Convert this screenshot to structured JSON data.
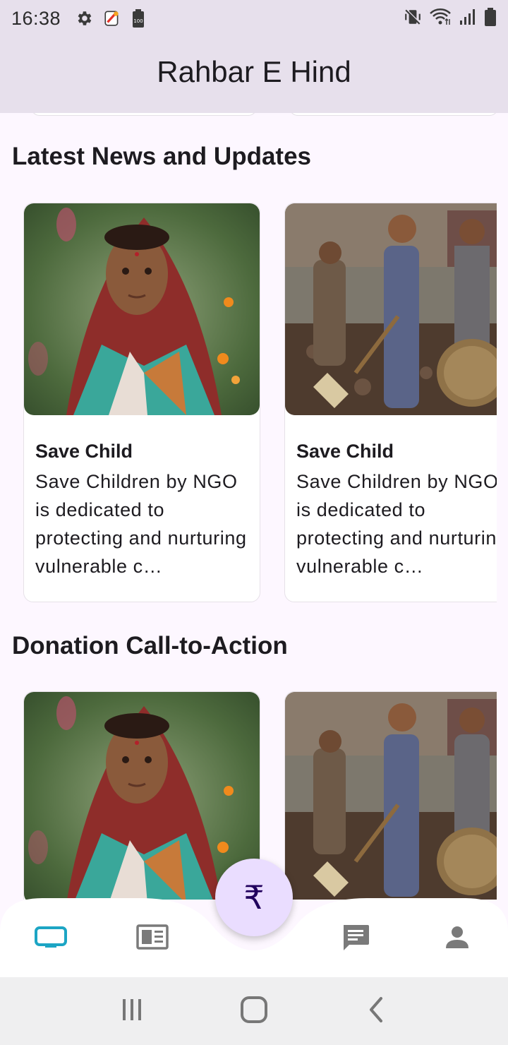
{
  "status_bar": {
    "time": "16:38",
    "left_icons": [
      "settings-icon",
      "app-notification-icon",
      "battery-saver-icon"
    ],
    "right_icons": [
      "vibrate-mute-icon",
      "wifi-icon",
      "signal-icon",
      "battery-icon"
    ],
    "battery_small_label": "100"
  },
  "app_bar": {
    "title": "Rahbar E Hind"
  },
  "sections": [
    {
      "title": "Latest News and Updates",
      "cards": [
        {
          "title": "Save Child",
          "text": "Save Children by NGO is dedicated to protecting and nurturing vulnerable c…",
          "image": "girl-portrait"
        },
        {
          "title": "Save Child",
          "text": "Save Children by NGO is dedicated to protecting and nurturing vulnerable c…",
          "image": "child-laborers"
        }
      ]
    },
    {
      "title": "Donation Call-to-Action",
      "cards": [
        {
          "image": "girl-portrait"
        },
        {
          "image": "child-laborers"
        }
      ]
    }
  ],
  "fab": {
    "symbol": "₹",
    "icon": "rupee-icon"
  },
  "bottom_nav": {
    "items": [
      {
        "name": "home",
        "icon": "tv-icon",
        "active": true
      },
      {
        "name": "news",
        "icon": "newspaper-icon",
        "active": false
      },
      {
        "name": "chat",
        "icon": "chat-icon",
        "active": false
      },
      {
        "name": "profile",
        "icon": "person-icon",
        "active": false
      }
    ],
    "active_color": "#1ca5c4",
    "inactive_color": "#7a7a7a"
  },
  "system_nav": [
    "recents-icon",
    "home-icon",
    "back-icon"
  ]
}
